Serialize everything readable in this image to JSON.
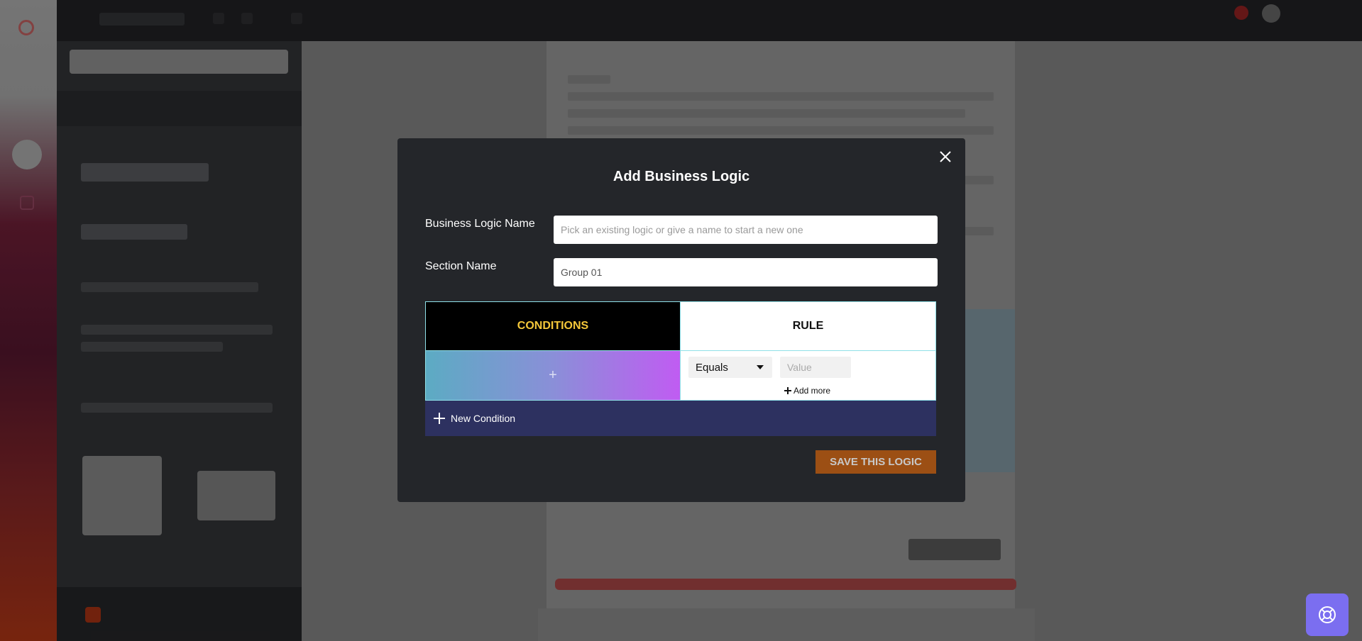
{
  "modal": {
    "title": "Add Business Logic",
    "business_logic_name_label": "Business Logic Name",
    "business_logic_name_placeholder": "Pick an existing logic or give a name to start a new one",
    "section_name_label": "Section Name",
    "section_name_value": "Group 01",
    "conditions_tab": "CONDITIONS",
    "rule_tab": "RULE",
    "condition_add_symbol": "+",
    "operator_selected": "Equals",
    "value_placeholder": "Value",
    "add_more_label": "Add more",
    "new_condition_label": "New Condition",
    "save_button": "SAVE THIS LOGIC"
  },
  "icons": {
    "close": "close-icon",
    "help": "help-lifebuoy-icon",
    "add": "plus-icon"
  },
  "colors": {
    "modal_bg": "#24262a",
    "conditions_text": "#f5c83a",
    "new_condition_bg": "#2d3160",
    "save_bg": "#9c4f14",
    "help_bg": "#7b6ef0"
  }
}
